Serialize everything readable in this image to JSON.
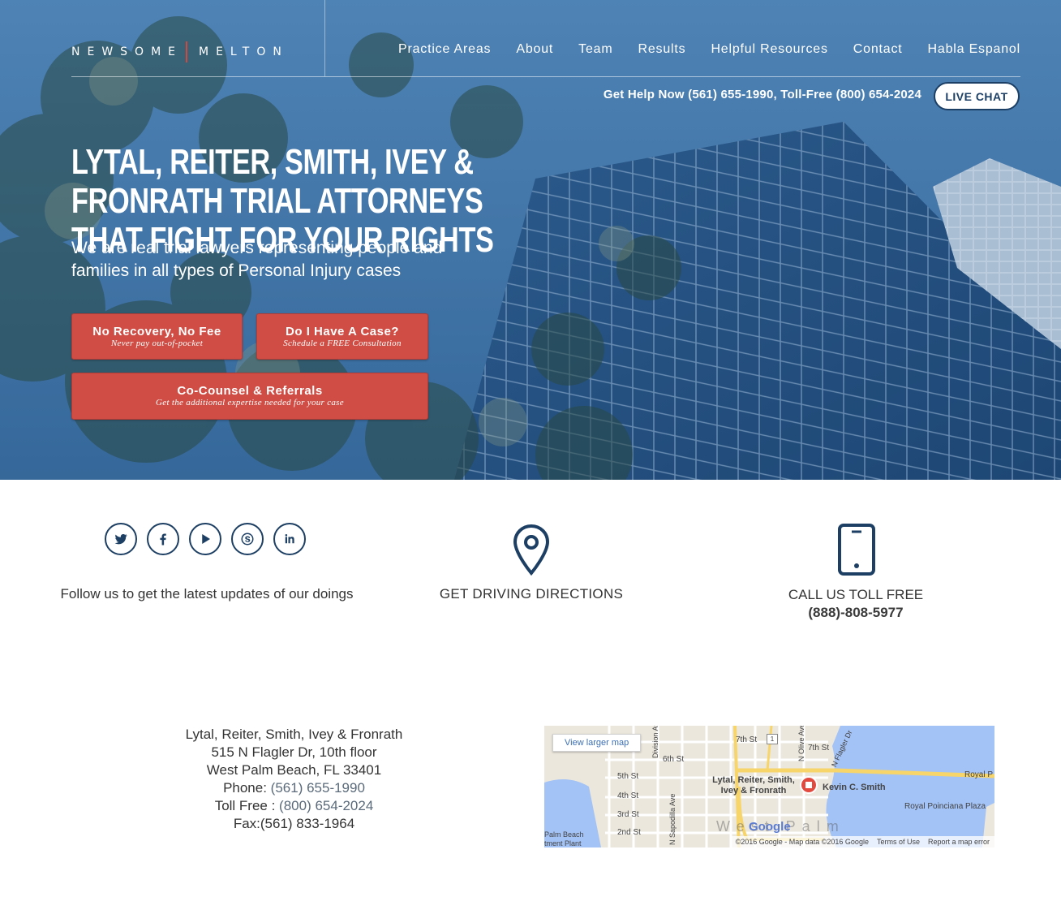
{
  "brand": {
    "logo_left": "NEWSOME",
    "logo_right": "MELTON",
    "accent": "#cf4d44",
    "navy": "#1d3f63"
  },
  "nav": {
    "items": [
      "Practice Areas",
      "About",
      "Team",
      "Results",
      "Helpful Resources",
      "Contact",
      "Habla Espanol"
    ]
  },
  "contact_bar": {
    "text": "Get Help Now (561) 655-1990, Toll-Free (800) 654-2024",
    "live_chat": "LIVE CHAT"
  },
  "hero": {
    "headline": "Lytal, Reiter, Smith, Ivey & Fronrath Trial Attorneys That Fight For Your Rights",
    "subhead": "We are real trial lawyers representing people and families in all types of Personal Injury cases"
  },
  "ctas": [
    {
      "title": "No Recovery, No Fee",
      "sub": "Never pay out-of-pocket"
    },
    {
      "title": "Do I Have A Case?",
      "sub": "Schedule a FREE Consultation"
    },
    {
      "title": "Co-Counsel & Referrals",
      "sub": "Get the additional expertise needed for your case"
    }
  ],
  "social": {
    "icons": [
      "twitter-icon",
      "facebook-icon",
      "youtube-icon",
      "skype-icon",
      "linkedin-icon"
    ],
    "text": "Follow us to get the latest updates of our doings"
  },
  "directions": {
    "text": "GET DRIVING DIRECTIONS",
    "icon": "map-pin-icon"
  },
  "call": {
    "label": "CALL US TOLL FREE",
    "number": "(888)-808-5977",
    "icon": "mobile-phone-icon"
  },
  "address": {
    "firm": "Lytal, Reiter, Smith, Ivey & Fronrath",
    "street": "515 N Flagler Dr, 10th floor",
    "city": "West Palm Beach, FL 33401",
    "phone_label": "Phone: ",
    "phone": "(561) 655-1990",
    "tollfree_label": "Toll Free : ",
    "tollfree": "(800) 654-2024",
    "fax": "Fax:(561) 833-1964"
  },
  "map": {
    "view_larger": "View larger map",
    "marker_label": "Lytal, Reiter, Smith, Ivey & Fronrath",
    "marker_label_2": "Kevin C. Smith",
    "streets": [
      "7th St",
      "6th St",
      "5th St",
      "4th St",
      "3rd St",
      "2nd St",
      "7th St",
      "Division Ave",
      "N Sapodilla Ave",
      "N Olive Ave",
      "N Flagler Dr",
      "Royal P"
    ],
    "places": [
      "Royal Poinciana Plaza",
      "Palm Beach",
      "tment Plant",
      "West Palm"
    ],
    "route": "1",
    "logo": "Google",
    "footer": [
      "©2016 Google - Map data ©2016 Google",
      "Terms of Use",
      "Report a map error"
    ]
  }
}
